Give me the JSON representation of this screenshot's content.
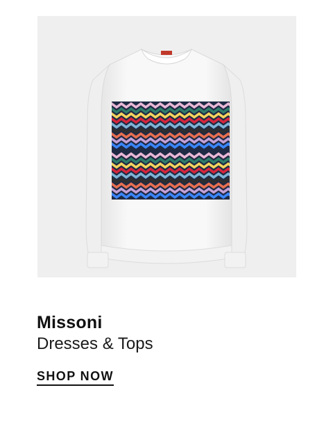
{
  "product": {
    "brand": "Missoni",
    "category": "Dresses & Tops",
    "cta_label": "SHOP NOW",
    "image_icon": "sweatshirt-image"
  },
  "colors": {
    "background": "#ffffff",
    "image_background": "#efefef",
    "text": "#111111",
    "garment": "#f7f7f7",
    "neck_tag": "#c0392b",
    "zigzag_stripes": [
      "#1f2a44",
      "#e8b8d6",
      "#2f7d6a",
      "#f4d35e",
      "#d7263d",
      "#7fb3d5",
      "#2e2e2e",
      "#e76f51",
      "#c4a1d6",
      "#3a86ff"
    ]
  }
}
